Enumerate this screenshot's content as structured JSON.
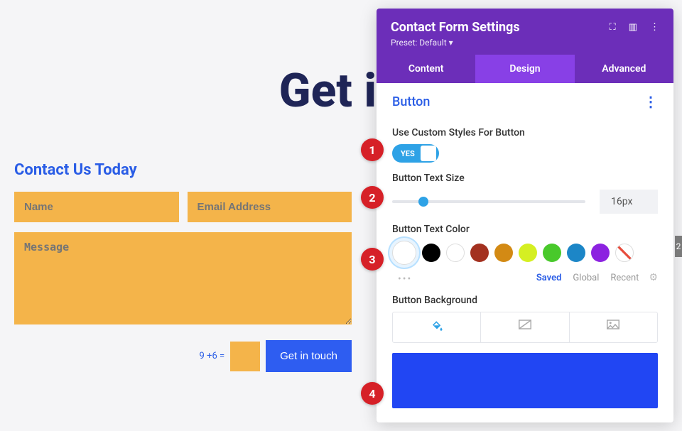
{
  "preview": {
    "page_title": "Get in",
    "form_subtitle": "Contact Us Today",
    "name_placeholder": "Name",
    "email_placeholder": "Email Address",
    "message_placeholder": "Message",
    "captcha_prompt": "9 +6 =",
    "submit_label": "Get in touch"
  },
  "panel": {
    "title": "Contact Form Settings",
    "preset_label": "Preset: Default ▾",
    "tabs": {
      "content": "Content",
      "design": "Design",
      "advanced": "Advanced"
    },
    "section": {
      "title": "Button"
    },
    "custom_styles": {
      "label": "Use Custom Styles For Button",
      "toggle_text": "YES"
    },
    "text_size": {
      "label": "Button Text Size",
      "value": "16px"
    },
    "text_color": {
      "label": "Button Text Color",
      "swatches": [
        {
          "name": "current",
          "hex": "#ffffff",
          "selected": true,
          "light": true
        },
        {
          "name": "black",
          "hex": "#000000"
        },
        {
          "name": "white",
          "hex": "#ffffff",
          "light": true
        },
        {
          "name": "dark-red",
          "hex": "#a33120"
        },
        {
          "name": "amber",
          "hex": "#d38a14"
        },
        {
          "name": "lime",
          "hex": "#d5ef22"
        },
        {
          "name": "green",
          "hex": "#49c92b"
        },
        {
          "name": "blue",
          "hex": "#1c86c7"
        },
        {
          "name": "purple",
          "hex": "#8c22e0"
        },
        {
          "name": "none",
          "diag": true
        }
      ],
      "more": "•••",
      "swatch_tabs": {
        "saved": "Saved",
        "global": "Global",
        "recent": "Recent"
      }
    },
    "background": {
      "label": "Button Background",
      "preview_color": "#2146f3"
    }
  },
  "annotations": {
    "a1": "1",
    "a2": "2",
    "a3": "3",
    "a4": "4"
  },
  "edge_marker": "2"
}
